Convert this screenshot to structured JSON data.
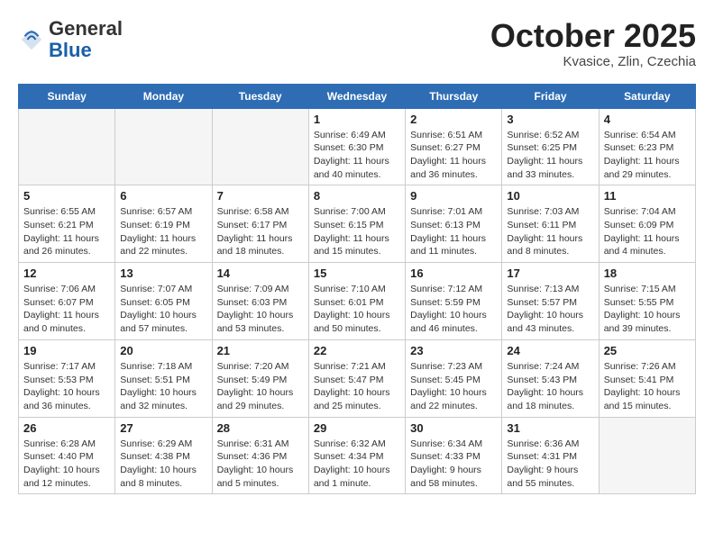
{
  "header": {
    "logo_line1": "General",
    "logo_line2": "Blue",
    "month": "October 2025",
    "location": "Kvasice, Zlin, Czechia"
  },
  "days_of_week": [
    "Sunday",
    "Monday",
    "Tuesday",
    "Wednesday",
    "Thursday",
    "Friday",
    "Saturday"
  ],
  "weeks": [
    [
      {
        "num": "",
        "info": ""
      },
      {
        "num": "",
        "info": ""
      },
      {
        "num": "",
        "info": ""
      },
      {
        "num": "1",
        "info": "Sunrise: 6:49 AM\nSunset: 6:30 PM\nDaylight: 11 hours and 40 minutes."
      },
      {
        "num": "2",
        "info": "Sunrise: 6:51 AM\nSunset: 6:27 PM\nDaylight: 11 hours and 36 minutes."
      },
      {
        "num": "3",
        "info": "Sunrise: 6:52 AM\nSunset: 6:25 PM\nDaylight: 11 hours and 33 minutes."
      },
      {
        "num": "4",
        "info": "Sunrise: 6:54 AM\nSunset: 6:23 PM\nDaylight: 11 hours and 29 minutes."
      }
    ],
    [
      {
        "num": "5",
        "info": "Sunrise: 6:55 AM\nSunset: 6:21 PM\nDaylight: 11 hours and 26 minutes."
      },
      {
        "num": "6",
        "info": "Sunrise: 6:57 AM\nSunset: 6:19 PM\nDaylight: 11 hours and 22 minutes."
      },
      {
        "num": "7",
        "info": "Sunrise: 6:58 AM\nSunset: 6:17 PM\nDaylight: 11 hours and 18 minutes."
      },
      {
        "num": "8",
        "info": "Sunrise: 7:00 AM\nSunset: 6:15 PM\nDaylight: 11 hours and 15 minutes."
      },
      {
        "num": "9",
        "info": "Sunrise: 7:01 AM\nSunset: 6:13 PM\nDaylight: 11 hours and 11 minutes."
      },
      {
        "num": "10",
        "info": "Sunrise: 7:03 AM\nSunset: 6:11 PM\nDaylight: 11 hours and 8 minutes."
      },
      {
        "num": "11",
        "info": "Sunrise: 7:04 AM\nSunset: 6:09 PM\nDaylight: 11 hours and 4 minutes."
      }
    ],
    [
      {
        "num": "12",
        "info": "Sunrise: 7:06 AM\nSunset: 6:07 PM\nDaylight: 11 hours and 0 minutes."
      },
      {
        "num": "13",
        "info": "Sunrise: 7:07 AM\nSunset: 6:05 PM\nDaylight: 10 hours and 57 minutes."
      },
      {
        "num": "14",
        "info": "Sunrise: 7:09 AM\nSunset: 6:03 PM\nDaylight: 10 hours and 53 minutes."
      },
      {
        "num": "15",
        "info": "Sunrise: 7:10 AM\nSunset: 6:01 PM\nDaylight: 10 hours and 50 minutes."
      },
      {
        "num": "16",
        "info": "Sunrise: 7:12 AM\nSunset: 5:59 PM\nDaylight: 10 hours and 46 minutes."
      },
      {
        "num": "17",
        "info": "Sunrise: 7:13 AM\nSunset: 5:57 PM\nDaylight: 10 hours and 43 minutes."
      },
      {
        "num": "18",
        "info": "Sunrise: 7:15 AM\nSunset: 5:55 PM\nDaylight: 10 hours and 39 minutes."
      }
    ],
    [
      {
        "num": "19",
        "info": "Sunrise: 7:17 AM\nSunset: 5:53 PM\nDaylight: 10 hours and 36 minutes."
      },
      {
        "num": "20",
        "info": "Sunrise: 7:18 AM\nSunset: 5:51 PM\nDaylight: 10 hours and 32 minutes."
      },
      {
        "num": "21",
        "info": "Sunrise: 7:20 AM\nSunset: 5:49 PM\nDaylight: 10 hours and 29 minutes."
      },
      {
        "num": "22",
        "info": "Sunrise: 7:21 AM\nSunset: 5:47 PM\nDaylight: 10 hours and 25 minutes."
      },
      {
        "num": "23",
        "info": "Sunrise: 7:23 AM\nSunset: 5:45 PM\nDaylight: 10 hours and 22 minutes."
      },
      {
        "num": "24",
        "info": "Sunrise: 7:24 AM\nSunset: 5:43 PM\nDaylight: 10 hours and 18 minutes."
      },
      {
        "num": "25",
        "info": "Sunrise: 7:26 AM\nSunset: 5:41 PM\nDaylight: 10 hours and 15 minutes."
      }
    ],
    [
      {
        "num": "26",
        "info": "Sunrise: 6:28 AM\nSunset: 4:40 PM\nDaylight: 10 hours and 12 minutes."
      },
      {
        "num": "27",
        "info": "Sunrise: 6:29 AM\nSunset: 4:38 PM\nDaylight: 10 hours and 8 minutes."
      },
      {
        "num": "28",
        "info": "Sunrise: 6:31 AM\nSunset: 4:36 PM\nDaylight: 10 hours and 5 minutes."
      },
      {
        "num": "29",
        "info": "Sunrise: 6:32 AM\nSunset: 4:34 PM\nDaylight: 10 hours and 1 minute."
      },
      {
        "num": "30",
        "info": "Sunrise: 6:34 AM\nSunset: 4:33 PM\nDaylight: 9 hours and 58 minutes."
      },
      {
        "num": "31",
        "info": "Sunrise: 6:36 AM\nSunset: 4:31 PM\nDaylight: 9 hours and 55 minutes."
      },
      {
        "num": "",
        "info": ""
      }
    ]
  ]
}
